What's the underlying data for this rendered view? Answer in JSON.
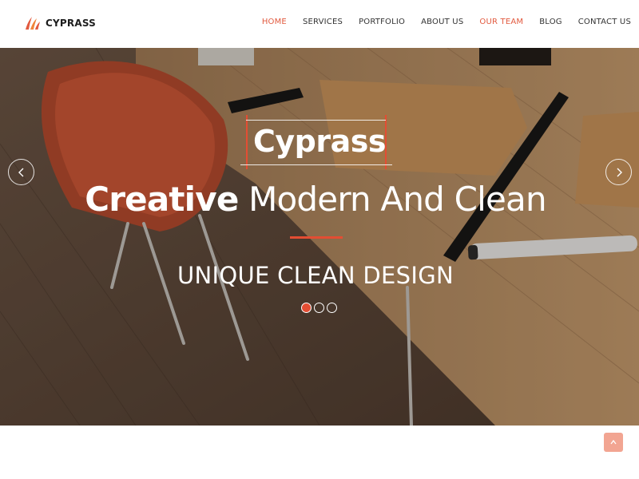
{
  "brand": {
    "name": "CYPRASS",
    "logo_icon": "flame-stripes-icon",
    "accent": "#e25a3f"
  },
  "nav": {
    "items": [
      {
        "label": "HOME",
        "active": true
      },
      {
        "label": "SERVICES",
        "active": false
      },
      {
        "label": "PORTFOLIO",
        "active": false
      },
      {
        "label": "ABOUT US",
        "active": false
      },
      {
        "label": "OUR TEAM",
        "active": true
      },
      {
        "label": "BLOG",
        "active": false
      },
      {
        "label": "CONTACT US",
        "active": false
      }
    ]
  },
  "hero": {
    "title": "Cyprass",
    "headline_bold": "Creative",
    "headline_rest": " Modern And Clean",
    "subtitle": "UNIQUE CLEAN DESIGN",
    "slides": [
      {
        "active": true
      },
      {
        "active": false
      },
      {
        "active": false
      }
    ],
    "prev_icon": "chevron-left-icon",
    "next_icon": "chevron-right-icon",
    "accent": "#e34d33"
  },
  "scroll_top": {
    "icon": "chevron-up-icon",
    "color": "#f2a592"
  }
}
